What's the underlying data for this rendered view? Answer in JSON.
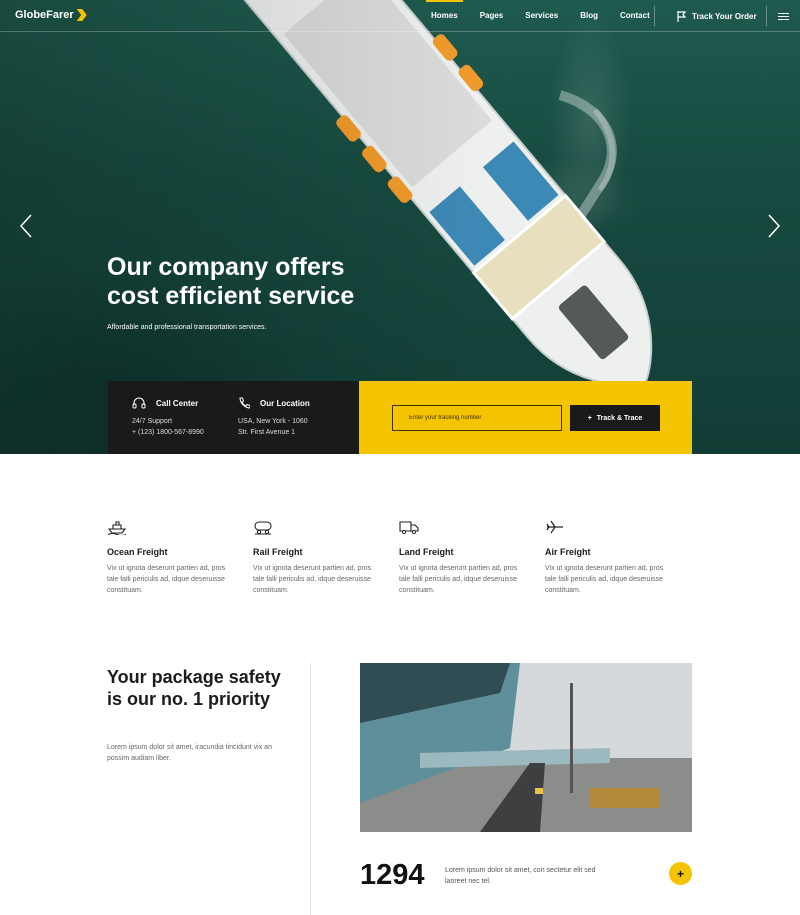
{
  "header": {
    "logo": "GlobeFarer",
    "nav": [
      "Homes",
      "Pages",
      "Services",
      "Blog",
      "Contact"
    ],
    "track_order": "Track Your Order"
  },
  "hero": {
    "title_line1": "Our company offers",
    "title_line2": "cost efficient service",
    "subtitle": "Affordable and professional transportation services."
  },
  "contact": {
    "call_center": {
      "title": "Call Center",
      "line1": "24/7 Support",
      "line2": "+ (123) 1800-567-8990"
    },
    "location": {
      "title": "Our Location",
      "line1": "USA, New York - 1060",
      "line2": "Str. First Avenue 1"
    }
  },
  "tracking": {
    "placeholder": "Enter your tracking number",
    "button": "Track & Trace"
  },
  "services": [
    {
      "title": "Ocean Freight",
      "text": "Vix ut ignota deserunt partien ad, pros tale falli periculis ad, idque deseruisse constituam.",
      "icon": "ship-icon"
    },
    {
      "title": "Rail Freight",
      "text": "Vix ut ignota deserunt partien ad, pros tale falli periculis ad, idque deseruisse constituam.",
      "icon": "train-icon"
    },
    {
      "title": "Land Freight",
      "text": "Vix ut ignota deserunt partien ad, pros tale falli periculis ad, idque deseruisse constituam.",
      "icon": "truck-icon"
    },
    {
      "title": "Air Freight",
      "text": "Vix ut ignota deserunt partien ad, pros tale falli periculis ad, idque deseruisse constituam.",
      "icon": "plane-icon"
    }
  ],
  "safety": {
    "title": "Your package safety is our no. 1 priority",
    "text": "Lorem ipsum dolor sit amet, iracundia tincidunt vix an possim audiam liber."
  },
  "counter": {
    "value": "1294",
    "text": "Lorem ipsum dolor sit amet, con sectetur elit sed laoreet nec tel.",
    "button": "+"
  },
  "colors": {
    "accent": "#f5c400",
    "dark": "#1a1a1a"
  }
}
